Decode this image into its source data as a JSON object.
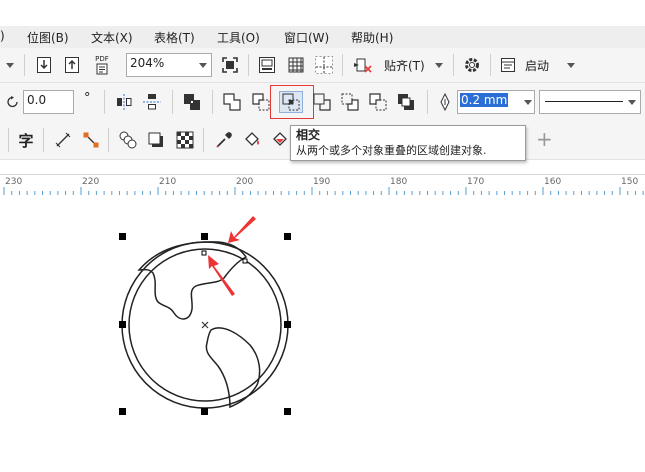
{
  "menu": {
    "items": [
      {
        "label": ")"
      },
      {
        "label": "位图(B)"
      },
      {
        "label": "文本(X)"
      },
      {
        "label": "表格(T)"
      },
      {
        "label": "工具(O)"
      },
      {
        "label": "窗口(W)"
      },
      {
        "label": "帮助(H)"
      }
    ]
  },
  "toolbar1": {
    "pdf_label": "PDF",
    "zoom_value": "204%",
    "snap_label": "贴齐(T)",
    "launch_label": "启动"
  },
  "toolbar2": {
    "rotation_value": "0.0",
    "degree_symbol": "°",
    "outline_width": "0.2 mm"
  },
  "toolbar3": {
    "text_tool_label": "字",
    "add_label": "+"
  },
  "tooltip": {
    "title": "相交",
    "description": "从两个或多个对象重叠的区域创建对象."
  },
  "ruler": {
    "labels": [
      "230",
      "220",
      "210",
      "200",
      "190",
      "180",
      "170",
      "160",
      "150"
    ]
  },
  "colors": {
    "highlight_border": "#e53935",
    "arrow_red": "#ee3333",
    "accent_blue": "#2b6fd6"
  }
}
